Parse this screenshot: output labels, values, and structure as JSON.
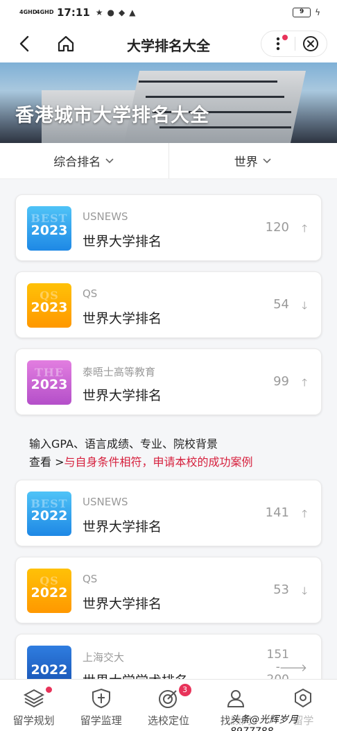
{
  "status_bar": {
    "network1": "4GHD",
    "network2": "4GHD",
    "time": "17:11",
    "battery": "9"
  },
  "nav": {
    "title": "大学排名大全"
  },
  "banner": {
    "title": "香港城市大学排名大全"
  },
  "filters": [
    {
      "label": "综合排名"
    },
    {
      "label": "世界"
    }
  ],
  "cards": [
    {
      "badge_bg": "BEST",
      "year": "2023",
      "source": "USNEWS",
      "name": "世界大学排名",
      "rank": "120",
      "trend": "up",
      "color": "blue"
    },
    {
      "badge_bg": "QS",
      "year": "2023",
      "source": "QS",
      "name": "世界大学排名",
      "rank": "54",
      "trend": "down",
      "color": "orange"
    },
    {
      "badge_bg": "THE",
      "year": "2023",
      "source": "泰晤士高等教育",
      "name": "世界大学排名",
      "rank": "99",
      "trend": "up",
      "color": "purple"
    },
    {
      "badge_bg": "BEST",
      "year": "2022",
      "source": "USNEWS",
      "name": "世界大学排名",
      "rank": "141",
      "trend": "up",
      "color": "blue"
    },
    {
      "badge_bg": "QS",
      "year": "2022",
      "source": "QS",
      "name": "世界大学排名",
      "rank": "53",
      "trend": "down",
      "color": "orange"
    },
    {
      "badge_bg": "",
      "year": "2022",
      "source": "上海交大",
      "name": "世界大学学术排名",
      "rank": "151",
      "rank_sep": "-",
      "rank_end": "200",
      "trend": "right",
      "color": "navy"
    }
  ],
  "promo": {
    "line1": "输入GPA、语言成绩、专业、院校背景",
    "line2_prefix": "查看 >",
    "line2_highlight": "与自身条件相符，申请本校的成功案例"
  },
  "tabs": [
    {
      "label": "留学规划",
      "icon": "layers-icon"
    },
    {
      "label": "留学监理",
      "icon": "shield-icon"
    },
    {
      "label": "选校定位",
      "icon": "target-icon",
      "badge": "3"
    },
    {
      "label": "找顾问",
      "icon": "person-icon"
    },
    {
      "label": "留学",
      "icon": "badge-icon"
    }
  ],
  "watermark": "头条@光辉岁月8977788",
  "colors": {
    "accent_red": "#d61f3c",
    "badge_red": "#e8335a"
  }
}
